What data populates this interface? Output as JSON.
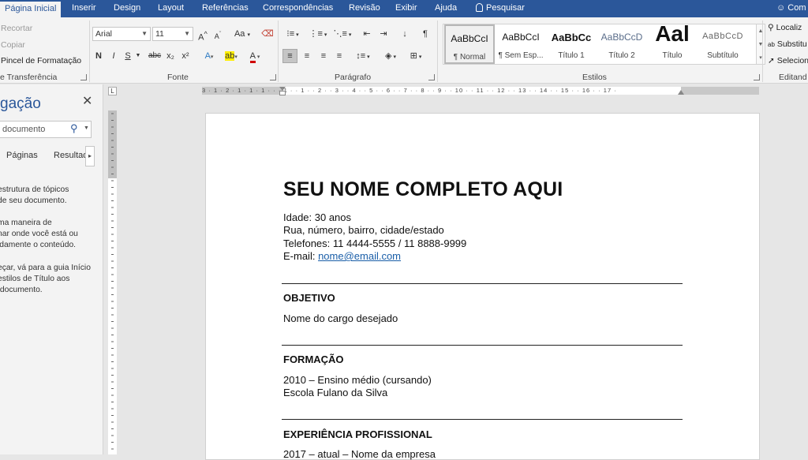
{
  "tabs": [
    "Página Inicial",
    "Inserir",
    "Design",
    "Layout",
    "Referências",
    "Correspondências",
    "Revisão",
    "Exibir",
    "Ajuda",
    "Pesquisar",
    "Com"
  ],
  "clipboard": {
    "cut": "Recortar",
    "copy": "Copiar",
    "format_painter": "Pincel de Formatação",
    "label": "e Transferência"
  },
  "font": {
    "name": "Arial",
    "size": "11",
    "label": "Fonte",
    "grow": "A",
    "shrink": "A",
    "case": "Aa",
    "bold": "N",
    "italic": "I",
    "underline": "S",
    "strike": "abc",
    "subscript": "x₂",
    "superscript": "x²",
    "effects": "A",
    "highlight": "ab",
    "color": "A"
  },
  "paragraph": {
    "label": "Parágrafo",
    "pilcrow": "¶"
  },
  "styles": {
    "label": "Estilos",
    "items": [
      {
        "preview": "AaBbCcI",
        "name": "¶ Normal"
      },
      {
        "preview": "AaBbCcI",
        "name": "¶ Sem Esp..."
      },
      {
        "preview": "AaBbCc",
        "name": "Título 1"
      },
      {
        "preview": "AaBbCcD",
        "name": "Título 2"
      },
      {
        "preview": "Aal",
        "name": "Título"
      },
      {
        "preview": "AaBbCcD",
        "name": "Subtítulo"
      }
    ]
  },
  "editing": {
    "find": "Localiz",
    "replace": "Substitu",
    "select": "Selecion",
    "label": "Editand"
  },
  "nav": {
    "title": "gação",
    "search": "documento",
    "tab_pages": "Páginas",
    "tab_results": "Resultad",
    "msg1": "estrutura de tópicos\nde seu documento.",
    "msg2": "ma maneira de\nnar onde você está ou\nidamente o conteúdo.",
    "msg3": "eçar, vá para a guia Início\nestilos de Título aos\n documento."
  },
  "ruler": {
    "h_numbers": "3 · 1 · 2 · 1 · 1 · 1 · · · 1 · · 1 · · 2 · · 3 · · 4 · · 5 · · 6 · · 7 · · 8 · · 9 · · 10 · · 11 · · 12 · · 13 · · 14 · · 15 · · 16 · · 17 ·"
  },
  "doc": {
    "name": "SEU NOME COMPLETO AQUI",
    "age": "Idade: 30 anos",
    "address": "Rua, número, bairro, cidade/estado",
    "phones": "Telefones: 11 4444-5555 / 11 8888-9999",
    "email_label": "E-mail: ",
    "email": "nome@email.com",
    "objective_head": "OBJETIVO",
    "objective": "Nome do cargo desejado",
    "education_head": "FORMAÇÃO",
    "education_1": "2010 – Ensino médio (cursando)",
    "education_2": "Escola Fulano da Silva",
    "experience_head": "EXPERIÊNCIA PROFISSIONAL",
    "experience_1": "2017 – atual – Nome da empresa"
  },
  "colors": {
    "accent": "#2b579a",
    "link": "#1a5ea8"
  }
}
